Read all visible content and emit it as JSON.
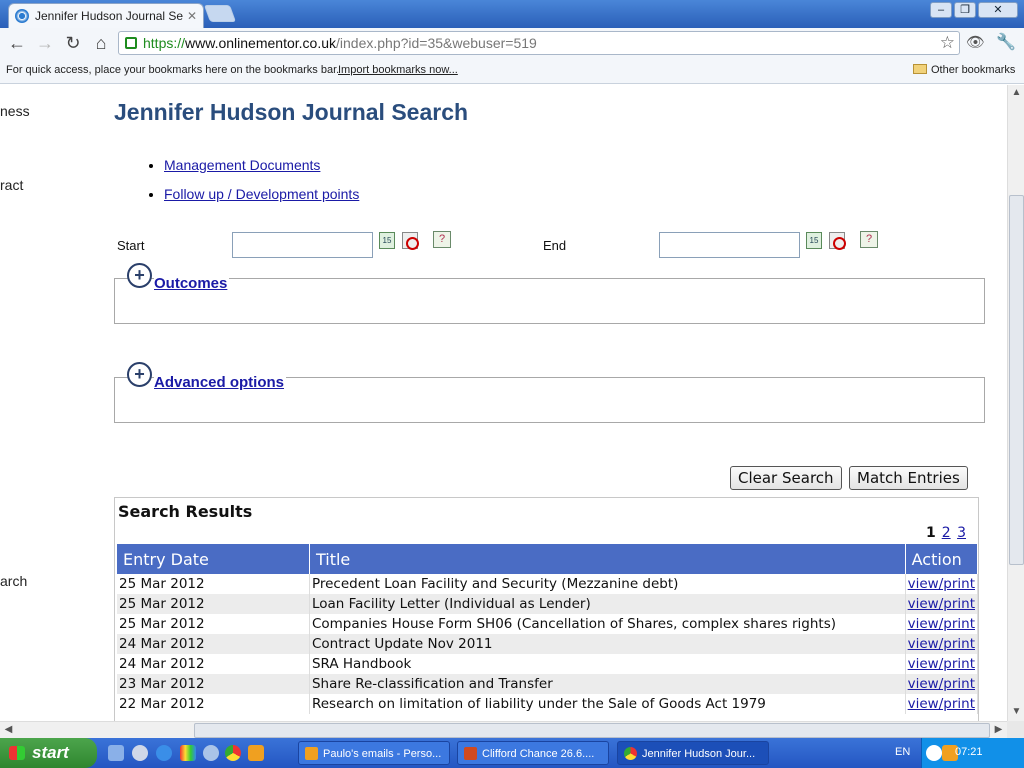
{
  "browser": {
    "tab_title": "Jennifer Hudson Journal Searc",
    "url_scheme": "https://",
    "url_host": "www.onlinementor.co.uk",
    "url_path": "/index.php?id=35&webuser=519",
    "bookmarks_message": "For quick access, place your bookmarks here on the bookmarks bar.",
    "import_bookmarks": "Import bookmarks now...",
    "other_bookmarks": "Other bookmarks"
  },
  "left_fragments": [
    "ness",
    "ract",
    "arch"
  ],
  "page": {
    "title": "Jennifer Hudson Journal Search",
    "links": [
      "Management Documents",
      "Follow up / Development points"
    ],
    "start_label": "Start",
    "end_label": "End",
    "start_value": "",
    "end_value": "",
    "calendar_icon_text": "15",
    "help_icon_text": "?",
    "outcomes_label": "Outcomes",
    "advanced_label": "Advanced options",
    "clear_button": "Clear Search",
    "match_button": "Match Entries"
  },
  "results": {
    "title": "Search Results",
    "current_page": "1",
    "pages": [
      "2",
      "3"
    ],
    "columns": [
      "Entry Date",
      "Title",
      "Action"
    ],
    "rows": [
      {
        "date": "25 Mar 2012",
        "title": "Precedent Loan Facility and Security (Mezzanine debt)",
        "action": "view/print"
      },
      {
        "date": "25 Mar 2012",
        "title": "Loan Facility Letter (Individual as Lender)",
        "action": "view/print"
      },
      {
        "date": "25 Mar 2012",
        "title": "Companies House Form SH06 (Cancellation of Shares, complex shares rights)",
        "action": "view/print"
      },
      {
        "date": "24 Mar 2012",
        "title": "Contract Update Nov 2011",
        "action": "view/print"
      },
      {
        "date": "24 Mar 2012",
        "title": "SRA Handbook",
        "action": "view/print"
      },
      {
        "date": "23 Mar 2012",
        "title": "Share Re-classification and Transfer",
        "action": "view/print"
      },
      {
        "date": "22 Mar 2012",
        "title": "Research on limitation of liability under the Sale of Goods Act 1979",
        "action": "view/print"
      }
    ]
  },
  "taskbar": {
    "start_label": "start",
    "tasks": [
      "Paulo's emails - Perso...",
      "Clifford Chance 26.6....",
      "Jennifer Hudson Jour..."
    ],
    "language": "EN",
    "clock": "07:21"
  },
  "colors": {
    "header_blue": "#4a6cc4",
    "title_blue": "#2a4d7d",
    "link_blue": "#1a1aa6"
  }
}
